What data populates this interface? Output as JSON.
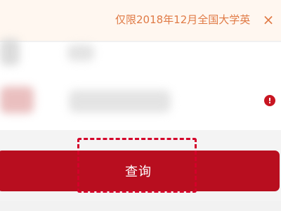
{
  "banner": {
    "text": "仅限2018年12月全国大学英",
    "close_icon": "close-icon"
  },
  "form": {
    "error_icon_text": "!"
  },
  "action": {
    "query_label": "查询"
  },
  "colors": {
    "accent": "#b80e1f",
    "banner_text": "#e07a45",
    "highlight_dash": "#d4002a"
  }
}
